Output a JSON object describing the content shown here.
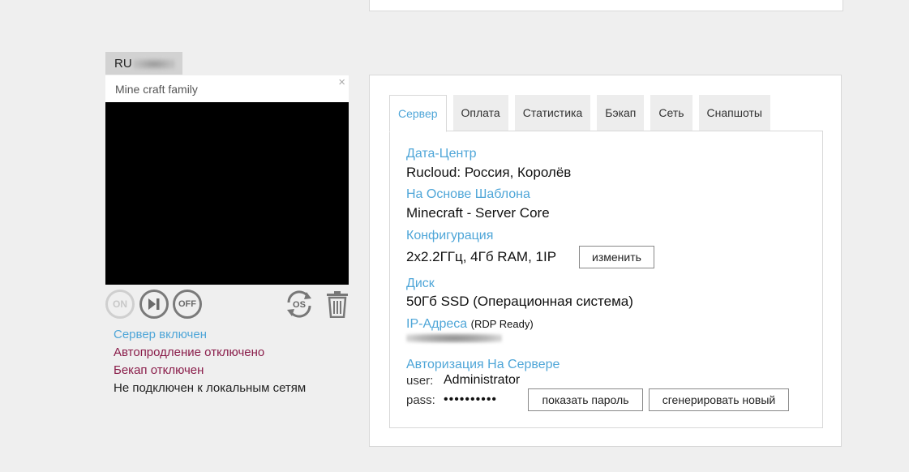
{
  "server_card": {
    "name_prefix": "RU",
    "title": "Mine craft family",
    "close_glyph": "×",
    "controls": {
      "on_label": "ON",
      "off_label": "OFF",
      "reinstall_label": "OS"
    },
    "status": {
      "server": "Сервер включен",
      "autorenew": "Автопродление отключено",
      "backup": "Бекап отключен",
      "network": "Не подключен к локальным сетям"
    }
  },
  "tabs": [
    {
      "label": "Сервер",
      "active": true
    },
    {
      "label": "Оплата",
      "active": false
    },
    {
      "label": "Статистика",
      "active": false
    },
    {
      "label": "Бэкап",
      "active": false
    },
    {
      "label": "Сеть",
      "active": false
    },
    {
      "label": "Снапшоты",
      "active": false
    }
  ],
  "details": {
    "datacenter_label": "Дата-Центр",
    "datacenter_value": "Rucloud: Россия, Королёв",
    "template_label": "На Основе Шаблона",
    "template_value": "Minecraft - Server Core",
    "config_label": "Конфигурация",
    "config_value": "2x2.2ГГц, 4Гб RAM, 1IP",
    "config_change_button": "изменить",
    "disk_label": "Диск",
    "disk_value": "50Гб SSD (Операционная система)",
    "ip_label": "IP-Адреса",
    "ip_note": "(RDP Ready)",
    "auth_label": "Авторизация На Сервере",
    "user_key": "user:",
    "user_value": "Administrator",
    "pass_key": "pass:",
    "pass_value": "••••••••••",
    "show_password_button": "показать пароль",
    "generate_password_button": "сгенерировать новый"
  },
  "colors": {
    "accent": "#4fa6d8",
    "warning": "#8a1d4a",
    "background": "#efefef"
  }
}
